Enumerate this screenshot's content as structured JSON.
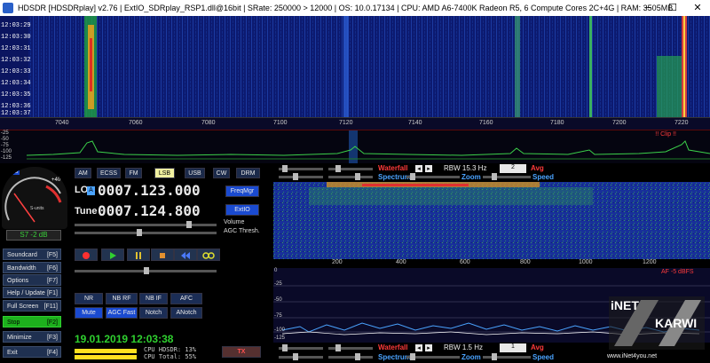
{
  "window": {
    "title": "HDSDR  [HDSDRplay]  v2.76  |  ExtIO_SDRplay_RSP1.dll@16bit  |  SRate: 250000 > 12000  |  OS: 10.0.17134  |  CPU: AMD A6-7400K Radeon R5, 6 Compute Cores 2C+4G  |  RAM: 3505MB",
    "min": "─",
    "max": "☐",
    "close": "✕"
  },
  "waterfall": {
    "times": [
      "12:03:29",
      "12:03:30",
      "12:03:31",
      "12:03:32",
      "12:03:33",
      "12:03:34",
      "12:03:35",
      "12:03:36",
      "12:03:37"
    ]
  },
  "freq_scale": {
    "ticks": [
      "7040",
      "7060",
      "7080",
      "7100",
      "7120",
      "7140",
      "7160",
      "7180",
      "7200",
      "7220"
    ],
    "clip_label": "!! Clip !!"
  },
  "spectrum": {
    "db_labels": [
      "-25",
      "-50",
      "-75",
      "-100",
      "-125"
    ]
  },
  "meter": {
    "rms_label": "RMS",
    "scale_plus": "+40",
    "s_units": "S-units",
    "reading": "S7 -2 dB"
  },
  "modes": [
    "AM",
    "ECSS",
    "FM",
    "LSB",
    "USB",
    "CW",
    "DRM"
  ],
  "lo": {
    "label": "LO",
    "a_label": "A",
    "value": "0007.123.000"
  },
  "tune": {
    "label": "Tune",
    "value": "0007.124.800"
  },
  "buttons": {
    "freqmgr": "FreqMgr",
    "extio": "ExtIO",
    "volume": "Volume",
    "agc_thresh": "AGC Thresh."
  },
  "left_buttons": [
    {
      "label": "Soundcard",
      "key": "[F5]"
    },
    {
      "label": "Bandwidth",
      "key": "[F6]"
    },
    {
      "label": "Options",
      "key": "[F7]"
    },
    {
      "label": "Help / Update",
      "key": "[F1]"
    },
    {
      "label": "Full Screen",
      "key": "[F11]"
    },
    {
      "label": "Stop",
      "key": "[F2]"
    },
    {
      "label": "Minimize",
      "key": "[F3]"
    },
    {
      "label": "Exit",
      "key": "[F4]"
    }
  ],
  "dsp_row1": [
    "NR",
    "NB RF",
    "NB IF",
    "AFC"
  ],
  "dsp_row2": [
    "Mute",
    "AGC Fast",
    "Notch",
    "ANotch"
  ],
  "status": {
    "datetime": "19.01.2019 12:03:38",
    "cpu_hdsdr": "CPU HDSDR:",
    "cpu_hdsdr_val": "13%",
    "cpu_total": "CPU Total:",
    "cpu_total_val": "55%",
    "tx": "TX"
  },
  "af_panel": {
    "waterfall": "Waterfall",
    "spectrum": "Spectrum",
    "rbw": "RBW 15.3 Hz",
    "rbw_sel": "2",
    "avg": "Avg",
    "zoom": "Zoom",
    "speed": "Speed",
    "scale": [
      "200",
      "400",
      "600",
      "800",
      "1000",
      "1200"
    ],
    "db_labels": [
      "0",
      "-25",
      "-50",
      "-75",
      "-100",
      "-125"
    ],
    "af_label": "AF -5 dBFS"
  },
  "af_panel2": {
    "waterfall": "Waterfall",
    "spectrum": "Spectrum",
    "rbw": "RBW 1.5 Hz",
    "rbw_sel": "1",
    "avg": "Avg",
    "zoom": "Zoom",
    "speed": "Speed"
  },
  "watermark": {
    "line1": "iNET",
    "line2": "KARWI",
    "url": "www.iNet4you.net"
  },
  "colors": {
    "accent_blue": "#4aa3ff",
    "red": "#ff3a3a",
    "green": "#1db01d",
    "status_green": "#2fd02f"
  }
}
